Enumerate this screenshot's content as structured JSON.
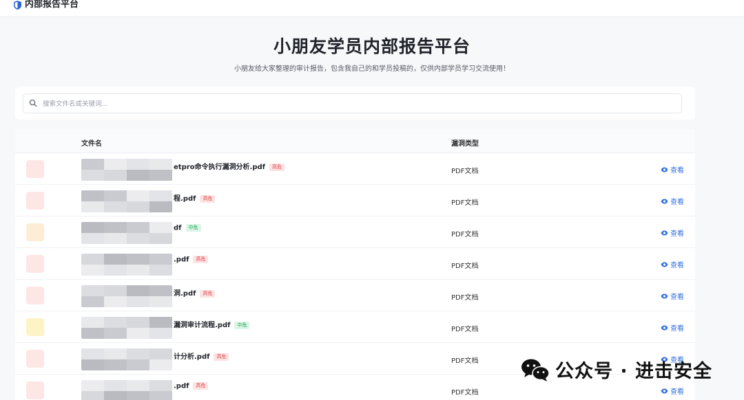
{
  "header": {
    "brand": "内部报告平台"
  },
  "hero": {
    "title": "小朋友学员内部报告平台",
    "subtitle": "小朋友给大家整理的审计报告，包含我自己的和学员投稿的，仅供内部学员学习交流使用！"
  },
  "search": {
    "placeholder": "搜索文件名或关键词..."
  },
  "table": {
    "columns": {
      "name": "文件名",
      "type": "漏洞类型"
    },
    "rows": [
      {
        "name": "etpro命令执行漏洞分析.pdf",
        "tag": "高危",
        "level": "high",
        "type": "PDF文档",
        "action": "查看",
        "icon_color": "#fde6e6"
      },
      {
        "name": "程.pdf",
        "tag": "高危",
        "level": "high",
        "type": "PDF文档",
        "action": "查看",
        "icon_color": "#fde6e6"
      },
      {
        "name": "df",
        "tag": "中危",
        "level": "medium",
        "type": "PDF文档",
        "action": "查看",
        "icon_color": "#fdecd6"
      },
      {
        "name": ".pdf",
        "tag": "高危",
        "level": "high",
        "type": "PDF文档",
        "action": "查看",
        "icon_color": "#fde6e6"
      },
      {
        "name": "洞.pdf",
        "tag": "高危",
        "level": "high",
        "type": "PDF文档",
        "action": "查看",
        "icon_color": "#fde6e6"
      },
      {
        "name": "漏洞审计流程.pdf",
        "tag": "中危",
        "level": "medium",
        "type": "PDF文档",
        "action": "查看",
        "icon_color": "#fdf3c4"
      },
      {
        "name": "计分析.pdf",
        "tag": "高危",
        "level": "high",
        "type": "PDF文档",
        "action": "查看",
        "icon_color": "#fde6e6"
      },
      {
        "name": ".pdf",
        "tag": "高危",
        "level": "high",
        "type": "PDF文档",
        "action": "查看",
        "icon_color": "#fde6e6"
      }
    ]
  },
  "colors": {
    "accent": "#3470e4",
    "high_bg": "#fde2e2",
    "high_fg": "#e0464a",
    "medium_bg": "#dcf5e6",
    "medium_fg": "#1fa862"
  },
  "watermark": {
    "text": "公众号 · 进击安全",
    "icon": "wechat-icon"
  }
}
